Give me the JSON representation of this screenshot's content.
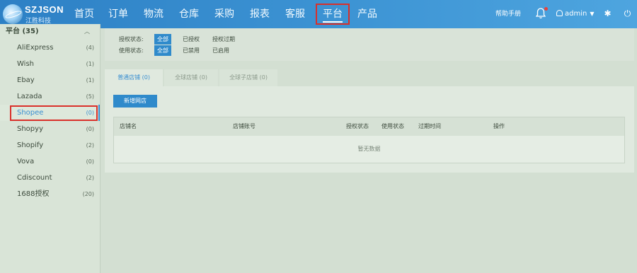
{
  "header": {
    "brand": "SZJSON",
    "brand_sub": "江胜科技",
    "menu": [
      {
        "label": "首页"
      },
      {
        "label": "订单"
      },
      {
        "label": "物流"
      },
      {
        "label": "仓库"
      },
      {
        "label": "采购"
      },
      {
        "label": "报表"
      },
      {
        "label": "客服"
      },
      {
        "label": "平台",
        "active": true
      },
      {
        "label": "产品"
      }
    ],
    "help": "帮助手册",
    "user": "admin",
    "icons": [
      "bell-icon",
      "user-icon",
      "gear-icon",
      "power-icon"
    ]
  },
  "sidebar": {
    "title": "平台 (35)",
    "items": [
      {
        "label": "AliExpress",
        "count": "(4)"
      },
      {
        "label": "Wish",
        "count": "(1)"
      },
      {
        "label": "Ebay",
        "count": "(1)"
      },
      {
        "label": "Lazada",
        "count": "(5)"
      },
      {
        "label": "Shopee",
        "count": "(0)",
        "active": true
      },
      {
        "label": "Shopyy",
        "count": "(0)"
      },
      {
        "label": "Shopify",
        "count": "(2)"
      },
      {
        "label": "Vova",
        "count": "(0)"
      },
      {
        "label": "Cdiscount",
        "count": "(2)"
      },
      {
        "label": "1688授权",
        "count": "(20)"
      }
    ]
  },
  "filters": {
    "auth": {
      "label": "授权状态:",
      "options": [
        "全部",
        "已授权",
        "授权过期"
      ]
    },
    "usage": {
      "label": "使用状态:",
      "options": [
        "全部",
        "已禁用",
        "已启用"
      ]
    }
  },
  "tabs": [
    {
      "label": "普通店铺 (0)",
      "active": true
    },
    {
      "label": "全球店铺 (0)"
    },
    {
      "label": "全球子店铺 (0)"
    }
  ],
  "add_button": "新增网店",
  "table": {
    "headers": [
      "店铺名",
      "店铺账号",
      "授权状态",
      "使用状态",
      "过期时间",
      "操作"
    ],
    "empty": "暂无数据"
  },
  "colors": {
    "accent": "#2f8acb",
    "highlight_box": "#d9302a"
  }
}
